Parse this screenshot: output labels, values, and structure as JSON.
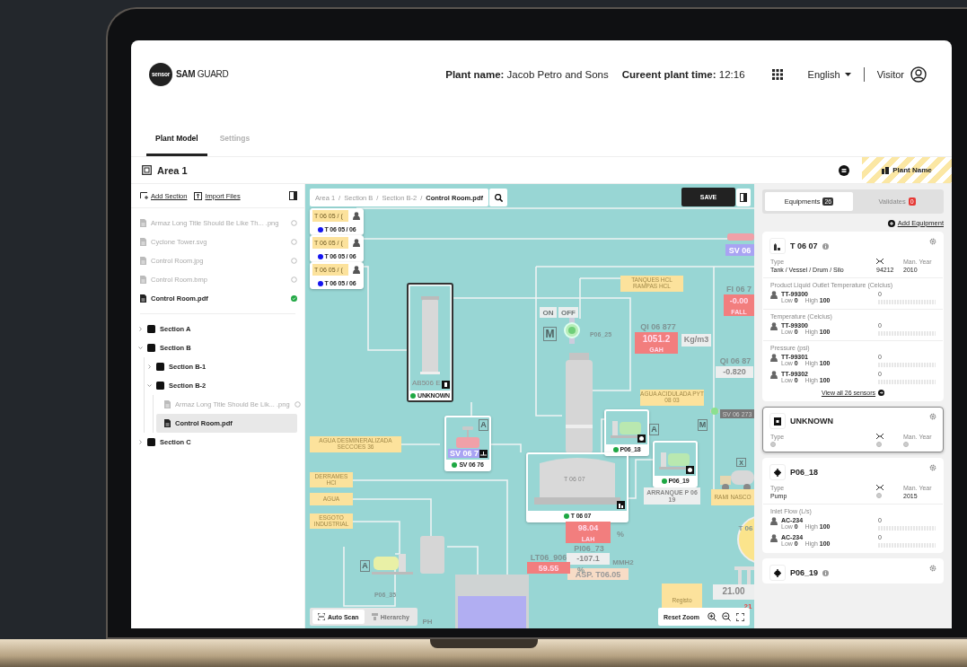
{
  "header": {
    "logo_badge": "sensor",
    "logo_text": "**SAM** GUARD",
    "plant_name_label": "Plant name:",
    "plant_name": "Jacob Petro and Sons",
    "time_label": "Cureent plant time:",
    "time": "12:16",
    "language": "English",
    "user": "Visitor"
  },
  "tabs": [
    {
      "label": "Plant Model",
      "selected": true
    },
    {
      "label": "Settings",
      "selected": false
    }
  ],
  "area": {
    "title": "Area 1",
    "plant_button": "Plant Name"
  },
  "files_panel": {
    "actions": [
      "Add Section",
      "Import Files"
    ],
    "files": [
      {
        "name": "Armaz Long Title Should Be Like Th... .png",
        "linked": false
      },
      {
        "name": "Cyclone Tower.svg",
        "linked": false
      },
      {
        "name": "Control Room.jpg",
        "linked": false
      },
      {
        "name": "Control Room.bmp",
        "linked": false
      },
      {
        "name": "Control Room.pdf",
        "linked": true
      }
    ],
    "tree": [
      {
        "kind": "section",
        "label": "Section A",
        "expanded": false
      },
      {
        "kind": "section",
        "label": "Section B",
        "expanded": true,
        "children": [
          {
            "kind": "section",
            "label": "Section B-1",
            "expanded": false
          },
          {
            "kind": "section",
            "label": "Section B-2",
            "expanded": true,
            "children": [
              {
                "kind": "file",
                "label": "Armaz Long Title Should Be Lik... .png",
                "linked": false,
                "selected": false
              },
              {
                "kind": "file",
                "label": "Control Room.pdf",
                "selected": true
              }
            ]
          }
        ]
      },
      {
        "kind": "section",
        "label": "Section C",
        "expanded": false
      }
    ]
  },
  "canvas": {
    "breadcrumb": [
      "Area 1",
      "Section B",
      "Section B-2",
      "Control Room.pdf"
    ],
    "breadcrumb_separator": "/",
    "save": "SAVE",
    "nodes": [
      {
        "kind": "tag",
        "title": "T 06 05 / (",
        "footer": "T 06 05 / 06",
        "color": "#1414f0",
        "selected": false
      },
      {
        "kind": "tag",
        "title": "T 06 05 / (",
        "footer": "T 06 05 / 06",
        "color": "#1414f0",
        "selected": false
      },
      {
        "kind": "tag",
        "title": "T 06 05 / (",
        "footer": "T 06 05 / 06",
        "color": "#1414f0",
        "selected": false
      },
      {
        "kind": "column",
        "title": "AB506 E",
        "footer": "UNKNOWN",
        "color": "#1ea843",
        "selected": true
      },
      {
        "kind": "valve",
        "title": "SV 06 7",
        "footer": "SV 06 76",
        "color": "#1ea843",
        "selected": false
      },
      {
        "kind": "pump",
        "footer": "P06_18",
        "color": "#1ea843",
        "selected": false
      },
      {
        "kind": "pump",
        "footer": "P06_19",
        "color": "#1ea843",
        "selected": false
      },
      {
        "kind": "tank",
        "title": "T 06 07",
        "footer": "T 06 07",
        "color": "#1ea843",
        "selected": false
      }
    ],
    "labels": [
      {
        "kind": "note",
        "text": "TANQUES HCL RAMPAS HCL"
      },
      {
        "kind": "switch",
        "text": "ON"
      },
      {
        "kind": "switch",
        "text": "OFF"
      },
      {
        "kind": "letter",
        "text": "M"
      },
      {
        "kind": "text",
        "text": "P06_25"
      },
      {
        "kind": "text",
        "text": "QI 06 877"
      },
      {
        "kind": "alarm",
        "text": "1051.2"
      },
      {
        "kind": "alarm",
        "text": "GAH"
      },
      {
        "kind": "reading",
        "text": "Kg/m3"
      },
      {
        "kind": "text",
        "text": "FI 06 7"
      },
      {
        "kind": "alarm",
        "text": "-0.00"
      },
      {
        "kind": "alarm",
        "text": "FALL"
      },
      {
        "kind": "text",
        "text": "QI 06 87"
      },
      {
        "kind": "reading",
        "text": "-0.820"
      },
      {
        "kind": "note",
        "text": "AGUA ACIDULADA PYT 08 03"
      },
      {
        "kind": "darktag",
        "text": "SV 06 273"
      },
      {
        "kind": "note",
        "text": "AGUA DESMINERALIZADA SECCOES 36"
      },
      {
        "kind": "note",
        "text": "DERRAMES HCl"
      },
      {
        "kind": "note",
        "text": "AGUA"
      },
      {
        "kind": "note",
        "text": "ESGOTO INDUSTRIAL"
      },
      {
        "kind": "reading",
        "text": "ARRANQUE P 06 19"
      },
      {
        "kind": "note",
        "text": "RAMI NASCO"
      },
      {
        "kind": "alarm",
        "text": "98.04"
      },
      {
        "kind": "alarm",
        "text": "LAH"
      },
      {
        "kind": "text",
        "text": "%"
      },
      {
        "kind": "text",
        "text": "PI06_73"
      },
      {
        "kind": "reading",
        "text": "-107.1"
      },
      {
        "kind": "text",
        "text": "MMH2"
      },
      {
        "kind": "setpoint",
        "text": "ASP. T06.05"
      },
      {
        "kind": "letter",
        "text": "A"
      },
      {
        "kind": "text",
        "text": "P06_35"
      },
      {
        "kind": "text",
        "text": "LT06_906"
      },
      {
        "kind": "alarm",
        "text": "59.55"
      },
      {
        "kind": "text",
        "text": "%"
      },
      {
        "kind": "text",
        "text": "T 06"
      },
      {
        "kind": "note",
        "text": "Registo"
      },
      {
        "kind": "reading",
        "text": "21.00"
      },
      {
        "kind": "redtext",
        "text": "21"
      },
      {
        "kind": "text",
        "text": "PH"
      },
      {
        "kind": "valvetag",
        "text": "SV 06"
      },
      {
        "kind": "letter",
        "text": "A"
      },
      {
        "kind": "letter",
        "text": "A"
      },
      {
        "kind": "letter",
        "text": "M"
      },
      {
        "kind": "letter",
        "text": "X"
      }
    ],
    "scan_buttons": [
      {
        "label": "Auto Scan",
        "disabled": false
      },
      {
        "label": "Hierarchy",
        "disabled": true
      }
    ],
    "reset_zoom": "Reset Zoom"
  },
  "equipment_panel": {
    "tabs": [
      {
        "label": "Equipments",
        "count": "26",
        "selected": true
      },
      {
        "label": "Validates",
        "count": "0",
        "selected": false
      }
    ],
    "add_label": "Add Equipment",
    "cards": [
      {
        "kind": "tank",
        "name": "T 06 07",
        "info": true,
        "highlighted": false,
        "type_label": "Type",
        "type": "Tank / Vessel / Drum / Silo",
        "serial": "94212",
        "year_label": "Man. Year",
        "year": "2010",
        "groups": [
          {
            "title": "Product Liquid Outlet Temperature (Celcius)",
            "sensors": [
              {
                "id": "TT-99300",
                "low_label": "Low",
                "low": "0",
                "high_label": "High",
                "high": "100",
                "value": "0"
              }
            ]
          },
          {
            "title": "Temperature (Celcius)",
            "sensors": [
              {
                "id": "TT-99300",
                "low_label": "Low",
                "low": "0",
                "high_label": "High",
                "high": "100",
                "value": "0"
              }
            ]
          },
          {
            "title": "Pressure (psi)",
            "sensors": [
              {
                "id": "TT-99301",
                "low_label": "Low",
                "low": "0",
                "high_label": "High",
                "high": "100",
                "value": "0"
              },
              {
                "id": "TT-99302",
                "low_label": "Low",
                "low": "0",
                "high_label": "High",
                "high": "100",
                "value": "0"
              }
            ]
          }
        ],
        "footer": "View all 26 sensors"
      },
      {
        "kind": "unknown",
        "name": "UNKNOWN",
        "info": false,
        "highlighted": true,
        "type_label": "Type",
        "year_label": "Man. Year"
      },
      {
        "kind": "pump",
        "name": "P06_18",
        "info": false,
        "highlighted": false,
        "type_label": "Type",
        "type": "Pump",
        "year_label": "Man. Year",
        "year": "2015",
        "groups": [
          {
            "title": "Inlet Flow (L/s)",
            "sensors": [
              {
                "id": "AC-234",
                "low_label": "Low",
                "low": "0",
                "high_label": "High",
                "high": "100",
                "value": "0"
              },
              {
                "id": "AC-234",
                "low_label": "Low",
                "low": "0",
                "high_label": "High",
                "high": "100",
                "value": "0"
              }
            ]
          }
        ]
      },
      {
        "kind": "pump",
        "name": "P06_19",
        "info": true,
        "highlighted": false
      }
    ]
  }
}
